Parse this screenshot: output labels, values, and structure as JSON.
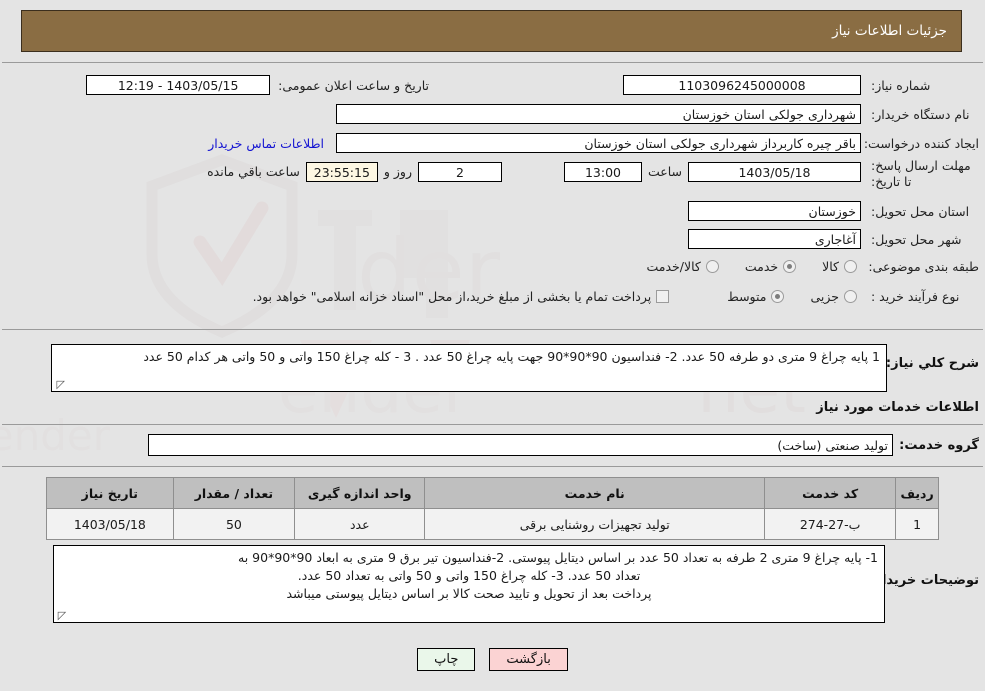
{
  "header": {
    "title": "جزئیات اطلاعات نیاز"
  },
  "form": {
    "need_number_label": "شماره نیاز:",
    "need_number_value": "1103096245000008",
    "announce_datetime_label": "تاریخ و ساعت اعلان عمومی:",
    "announce_datetime_value": "1403/05/15 - 12:19",
    "buyer_org_label": "نام دستگاه خریدار:",
    "buyer_org_value": "شهرداری جولکی استان خوزستان",
    "creator_label": "ایجاد کننده درخواست:",
    "creator_value": "باقر چیره کاربرداز شهرداری جولکی استان خوزستان",
    "contact_link": "اطلاعات تماس خریدار",
    "deadline_label": "مهلت ارسال پاسخ: تا تاریخ:",
    "deadline_date": "1403/05/18",
    "deadline_hour_label": "ساعت",
    "deadline_hour_value": "13:00",
    "remaining_days_value": "2",
    "remaining_days_label": "روز و",
    "remaining_time_value": "23:55:15",
    "remaining_time_label": "ساعت باقي مانده",
    "province_label": "استان محل تحویل:",
    "province_value": "خوزستان",
    "city_label": "شهر محل تحویل:",
    "city_value": "آغاجاری",
    "category_label": "طبقه بندی موضوعی:",
    "category_options": [
      {
        "label": "کالا",
        "selected": false
      },
      {
        "label": "خدمت",
        "selected": true
      },
      {
        "label": "کالا/خدمت",
        "selected": false
      }
    ],
    "process_label": "نوع فرآیند خرید :",
    "process_options": [
      {
        "label": "جزیی",
        "selected": false
      },
      {
        "label": "متوسط",
        "selected": true
      }
    ],
    "treasury_checkbox_label": "پرداخت تمام یا بخشی از مبلغ خرید،از محل \"اسناد خزانه اسلامی\" خواهد بود.",
    "treasury_checked": false
  },
  "description": {
    "label": "شرح کلي نیاز:",
    "value": "1 پایه چراغ 9 متری دو طرفه  50 عدد. 2- فنداسیون 90*90*90 جهت پایه چراغ  50 عدد . 3 - کله چراغ 150 واتی و 50 واتی هر کدام 50 عدد"
  },
  "services": {
    "section_title": "اطلاعات خدمات مورد نیاز",
    "group_label": "گروه خدمت:",
    "group_value": "تولید صنعتی (ساخت)",
    "table": {
      "headers": [
        "ردیف",
        "کد خدمت",
        "نام خدمت",
        "واحد اندازه گیری",
        "تعداد / مقدار",
        "تاریخ نیاز"
      ],
      "rows": [
        {
          "row_no": "1",
          "service_code": "ب-27-274",
          "service_name": "تولید تجهیزات روشنایی برقی",
          "unit": "عدد",
          "quantity": "50",
          "need_date": "1403/05/18"
        }
      ]
    }
  },
  "buyer_notes": {
    "label": "توضیحات خریدار:",
    "line1": "1- پایه چراغ 9 متری 2 طرفه به  تعداد 50 عدد بر اساس دیتایل پیوستی. 2-فنداسیون تیر برق 9 متری به ابعاد 90*90*90  به",
    "line2": "تعداد 50 عدد. 3- کله چراغ 150 واتی و 50 واتی به تعداد 50 عدد.",
    "line3": "پرداخت بعد از تحویل و تایید صحت کالا بر اساس دیتایل پیوستی میباشد"
  },
  "footer": {
    "print_label": "چاپ",
    "back_label": "بازگشت"
  },
  "watermark": {
    "text": "AriaTender.net"
  },
  "colors": {
    "header_bg": "#8a6d43",
    "page_bg": "#e4e4e4",
    "link": "#1414d2",
    "table_header_bg": "#bfbfbf",
    "print_btn_bg": "#eaf7ea",
    "back_btn_bg": "#fbd3d3"
  }
}
